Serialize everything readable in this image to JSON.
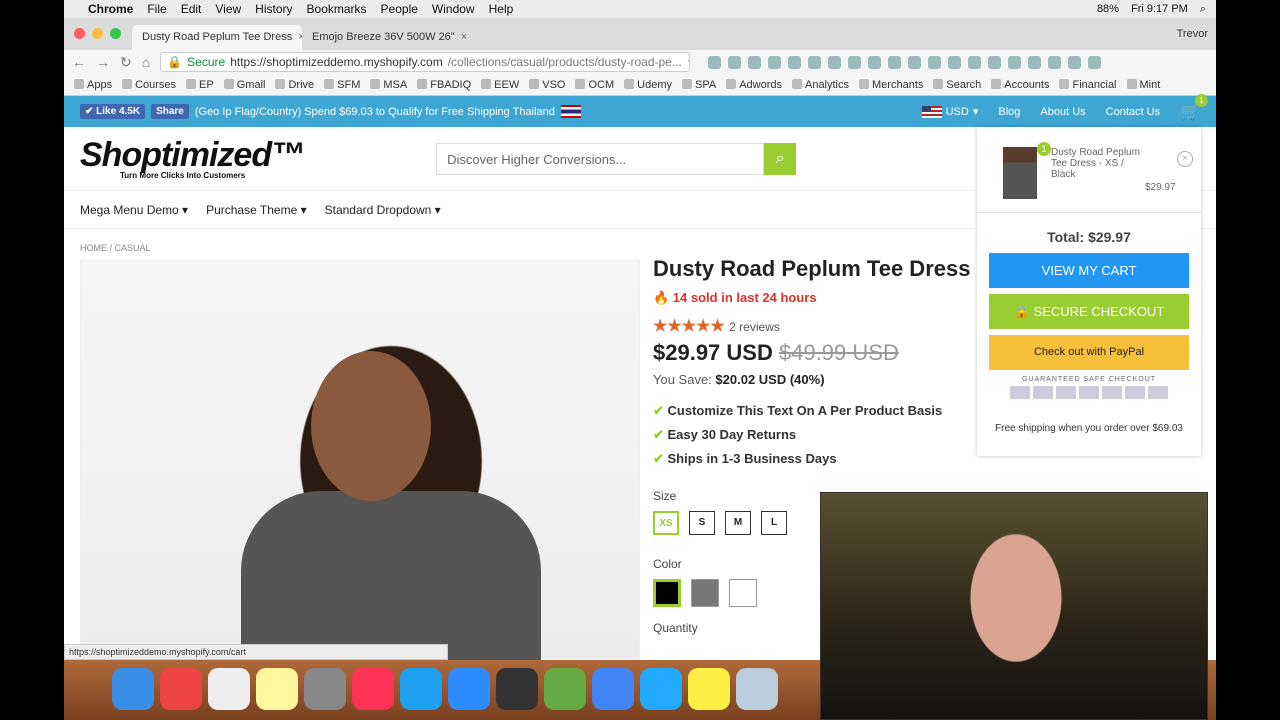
{
  "menubar": {
    "app": "Chrome",
    "items": [
      "File",
      "Edit",
      "View",
      "History",
      "Bookmarks",
      "People",
      "Window",
      "Help"
    ],
    "battery": "88%",
    "clock": "Fri 9:17 PM"
  },
  "browser": {
    "tabs": [
      {
        "title": "Dusty Road Peplum Tee Dress",
        "active": true
      },
      {
        "title": "Emojo Breeze 36V 500W 26\"",
        "active": false
      }
    ],
    "user": "Trevor",
    "secure_label": "Secure",
    "url_host": "https://shoptimizeddemo.myshopify.com",
    "url_path": "/collections/casual/products/dusty-road-pe...",
    "bookmarks": [
      "Apps",
      "Courses",
      "EP",
      "Gmail",
      "Drive",
      "SFM",
      "MSA",
      "FBADIQ",
      "EEW",
      "VSO",
      "OCM",
      "Udemy",
      "SPA",
      "Adwords",
      "Analytics",
      "Merchants",
      "Search",
      "Accounts",
      "Financial",
      "Mint"
    ]
  },
  "topbar": {
    "like": "✔ Like 4.5K",
    "share": "Share",
    "promo": "(Geo Ip Flag/Country) Spend $69.03 to Qualify for Free Shipping Thailand",
    "currency": "USD",
    "links": [
      "Blog",
      "About Us",
      "Contact Us"
    ],
    "cart_count": "1"
  },
  "header": {
    "logo": "Shoptimized™",
    "tagline": "Turn More Clicks Into Customers",
    "search_placeholder": "Discover Higher Conversions..."
  },
  "nav": [
    "Mega Menu Demo ▾",
    "Purchase Theme ▾",
    "Standard Dropdown ▾"
  ],
  "breadcrumb": "HOME / CASUAL",
  "product": {
    "title": "Dusty Road Peplum Tee Dress",
    "sold": "🔥 14 sold in last 24 hours",
    "rating": 5,
    "stars": "★★★★★",
    "reviews": "2 reviews",
    "price": "$29.97 USD",
    "compare_price": "$49.99 USD",
    "save_label": "You Save:",
    "save_value": "$20.02 USD (40%)",
    "features": [
      "Customize This Text On A Per Product Basis",
      "Easy 30 Day Returns",
      "Ships in 1-3 Business Days"
    ],
    "size_label": "Size",
    "sizes": [
      "XS",
      "S",
      "M",
      "L"
    ],
    "selected_size": "XS",
    "color_label": "Color",
    "colors": [
      "#000000",
      "#777777",
      "#ffffff"
    ],
    "quantity_label": "Quantity"
  },
  "cart": {
    "item_name": "Dusty Road Peplum Tee Dress - XS / Black",
    "item_qty": "1",
    "item_price": "$29.97",
    "total": "Total: $29.97",
    "view_cart": "VIEW MY CART",
    "checkout": "🔒 SECURE CHECKOUT",
    "paypal": "Check out with PayPal",
    "guarantee": "GUARANTEED SAFE CHECKOUT",
    "free_shipping": "Free shipping when you order over $69.03"
  },
  "status_url": "https://shoptimizeddemo.myshopify.com/cart",
  "colors": {
    "topbar": "#3ea6d3",
    "accent": "#9acd32",
    "view_cart": "#2196f3",
    "paypal": "#f7c03a"
  }
}
